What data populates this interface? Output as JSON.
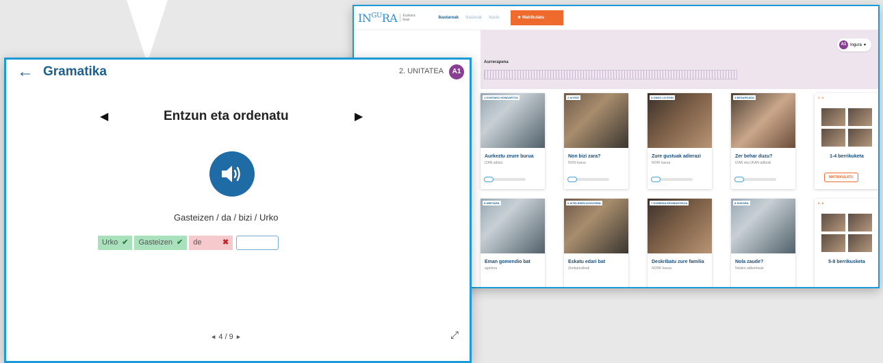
{
  "dashboard": {
    "logo": {
      "main": "INGURA",
      "sup": "GU",
      "subtitle": "Euskara ikasi"
    },
    "nav": [
      "Ikastaroak",
      "Ikaslerak",
      "Ikasle"
    ],
    "enroll_label": "★  Matrikulatu",
    "user": {
      "level": "A1",
      "name": "Ingura"
    },
    "progress_label": "Aurrerapena",
    "cards": [
      {
        "tag": "1 KONTAKO HONDARTZA",
        "title": "Aurkeztu zeure burua",
        "sub": "IZAN aditza"
      },
      {
        "tag": "2 AI ENO",
        "title": "Non bizi zara?",
        "sub": "NON kasua"
      },
      {
        "tag": "3 ONDO LO EGIN",
        "title": "Zure gustuak adierazi",
        "sub": "NORI kasua"
      },
      {
        "tag": "4 BESARKADA",
        "title": "Zer behar duzu?",
        "sub": "IZAN eta UKAN aditzak"
      },
      {
        "tag": "1 - 4",
        "title": "1-4 berrikuketa",
        "button": "MATRIKULATU"
      },
      {
        "tag": "5 URETARA",
        "title": "Eman gomendio bat",
        "sub": "agintera"
      },
      {
        "tag": "6 AITELEHEN DOGOSRIA",
        "title": "Eskatu edari bat",
        "sub": "Zenbatzaileak"
      },
      {
        "tag": "7 KOMEDIA EROMANTIKOA",
        "title": "Deskribatu zure familia",
        "sub": "NORK kasua"
      },
      {
        "tag": "8 SUDORA",
        "title": "Nola zaude?",
        "sub": "Nolako adberbioak"
      },
      {
        "tag": "5 - 8",
        "title": "5-8 berrikusketa"
      }
    ]
  },
  "grammar": {
    "title": "Gramatika",
    "unit": "2. UNITATEA",
    "level": "A1",
    "exercise_title": "Entzun eta ordenatu",
    "prompt": "Gasteizen / da / bizi / Urko",
    "answers": [
      {
        "text": "Urko",
        "status": "correct",
        "mark": "✔"
      },
      {
        "text": "Gasteizen",
        "status": "correct",
        "mark": "✔"
      },
      {
        "text": "de",
        "status": "wrong",
        "mark": "✖"
      }
    ],
    "pager": "4 / 9",
    "icons": [
      "back-arrow-icon",
      "prev-triangle-icon",
      "next-triangle-icon",
      "speaker-icon",
      "expand-icon"
    ]
  }
}
